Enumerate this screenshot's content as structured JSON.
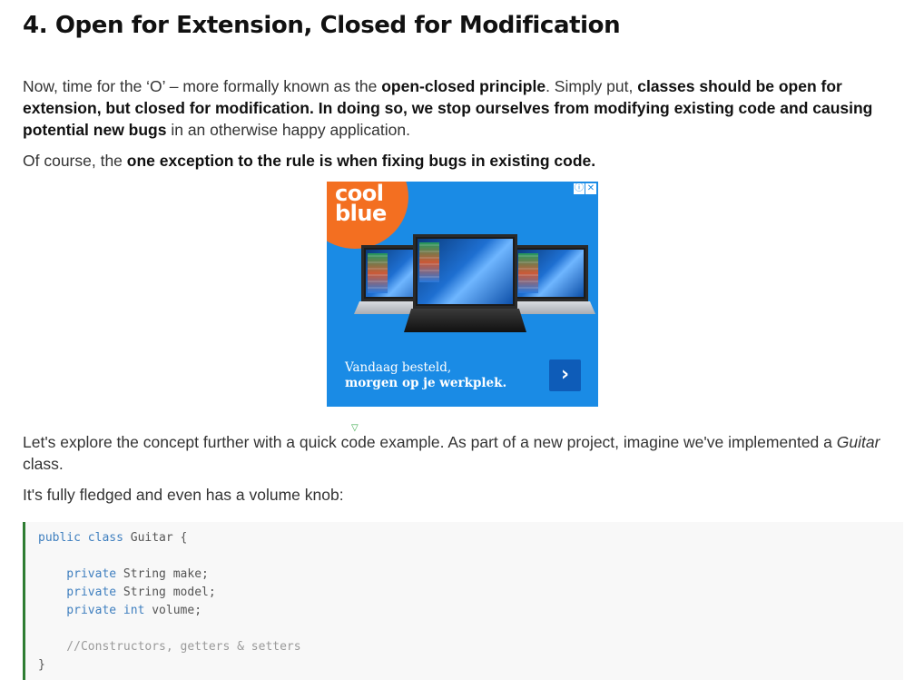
{
  "article": {
    "title": "4. Open for Extension, Closed for Modification",
    "p1": {
      "a": "Now, time for the ‘O’ – more formally known as the ",
      "b": "open-closed principle",
      "c": ". Simply put, ",
      "d": "classes should be open for extension, but closed for modification. In doing so, we stop ourselves from modifying existing code and causing potential new bugs",
      "e": " in an otherwise happy application."
    },
    "p2": {
      "a": "Of course, the ",
      "b": "one exception to the rule is when fixing bugs in existing code."
    },
    "p3": {
      "a": "Let's explore the concept further with a quick code example. As part of a new project, imagine we've implemented a ",
      "b": "Guitar",
      "c": " class."
    },
    "p4": "It's fully fledged and even has a volume knob:"
  },
  "ad": {
    "logo_line1": "cool",
    "logo_line2": "blue",
    "info_icon": "info-icon",
    "close_icon": "close-icon",
    "close_glyph": "✕",
    "info_glyph": "ⓘ",
    "text_line1": "Vandaag besteld,",
    "text_line2": "morgen op je werkplek.",
    "cta_glyph": "›",
    "background_color": "#1a8be5",
    "badge_color": "#f36f21",
    "marker_glyph": "▽"
  },
  "code": {
    "lines": [
      {
        "kw": "public class ",
        "rest": "Guitar {"
      },
      {
        "kw": "",
        "rest": ""
      },
      {
        "kw": "    private ",
        "rest": "String make;"
      },
      {
        "kw": "    private ",
        "rest": "String model;"
      },
      {
        "kw": "    private int ",
        "rest": "volume;"
      },
      {
        "kw": "",
        "rest": ""
      },
      {
        "kw": "",
        "rest": "    //Constructors, getters & setters"
      },
      {
        "kw": "",
        "rest": "}"
      }
    ],
    "accent_color": "#2e7d32"
  }
}
